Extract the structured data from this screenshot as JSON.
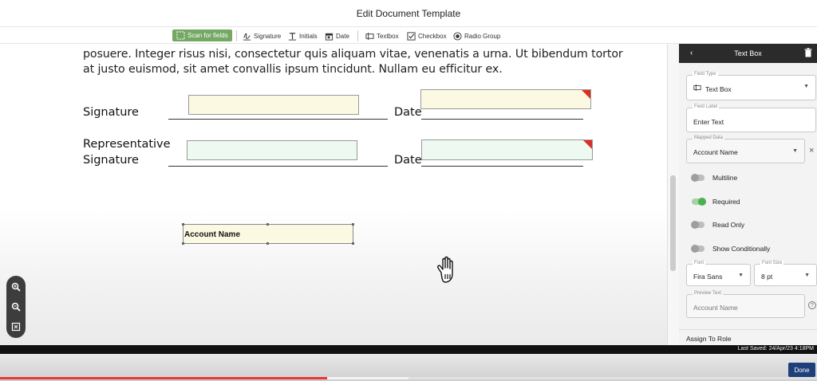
{
  "window": {
    "title": "Edit Document Template"
  },
  "toolbar": {
    "scan_label": "Scan for fields",
    "signature_label": "Signature",
    "initials_label": "Initials",
    "date_label": "Date",
    "textbox_label": "Textbox",
    "checkbox_label": "Checkbox",
    "radio_label": "Radio Group"
  },
  "document": {
    "lines": [
      "posuere. Integer risus nisi, consectetur quis aliquam vitae, venenatis a urna. Ut bibendum tortor",
      "at justo euismod, sit amet convallis ipsum tincidunt. Nullam eu efficitur ex."
    ],
    "signature_label": "Signature",
    "date_label": "Date",
    "rep_label_1": "Representative",
    "rep_label_2": "Signature",
    "account_field": "Account Name"
  },
  "panel": {
    "title": "Text Box",
    "field_type_label": "Field Type",
    "field_type_value": "Text Box",
    "field_label_label": "Field Label",
    "field_label_value": "Enter Text",
    "mapped_data_label": "Mapped Data",
    "mapped_data_value": "Account Name",
    "toggles": [
      {
        "label": "Multiline",
        "on": false
      },
      {
        "label": "Required",
        "on": true
      },
      {
        "label": "Read Only",
        "on": false
      },
      {
        "label": "Show Conditionally",
        "on": false
      }
    ],
    "font_label": "Font",
    "font_value": "Fira Sans",
    "font_size_label": "Font Size",
    "font_size_value": "8 pt",
    "preview_label": "Preview Text",
    "preview_value": "Account Name",
    "assign_label": "Assign To Role"
  },
  "status": {
    "last_saved": "Last Saved: 24/Apr/23 4:18PM"
  },
  "footer": {
    "done_label": "Done"
  },
  "video": {
    "played_fraction": 0.4,
    "buffered_fraction": 0.5
  },
  "colors": {
    "accent_green": "#74a863",
    "required_red": "#d93025",
    "done_blue": "#1f3f7a"
  }
}
